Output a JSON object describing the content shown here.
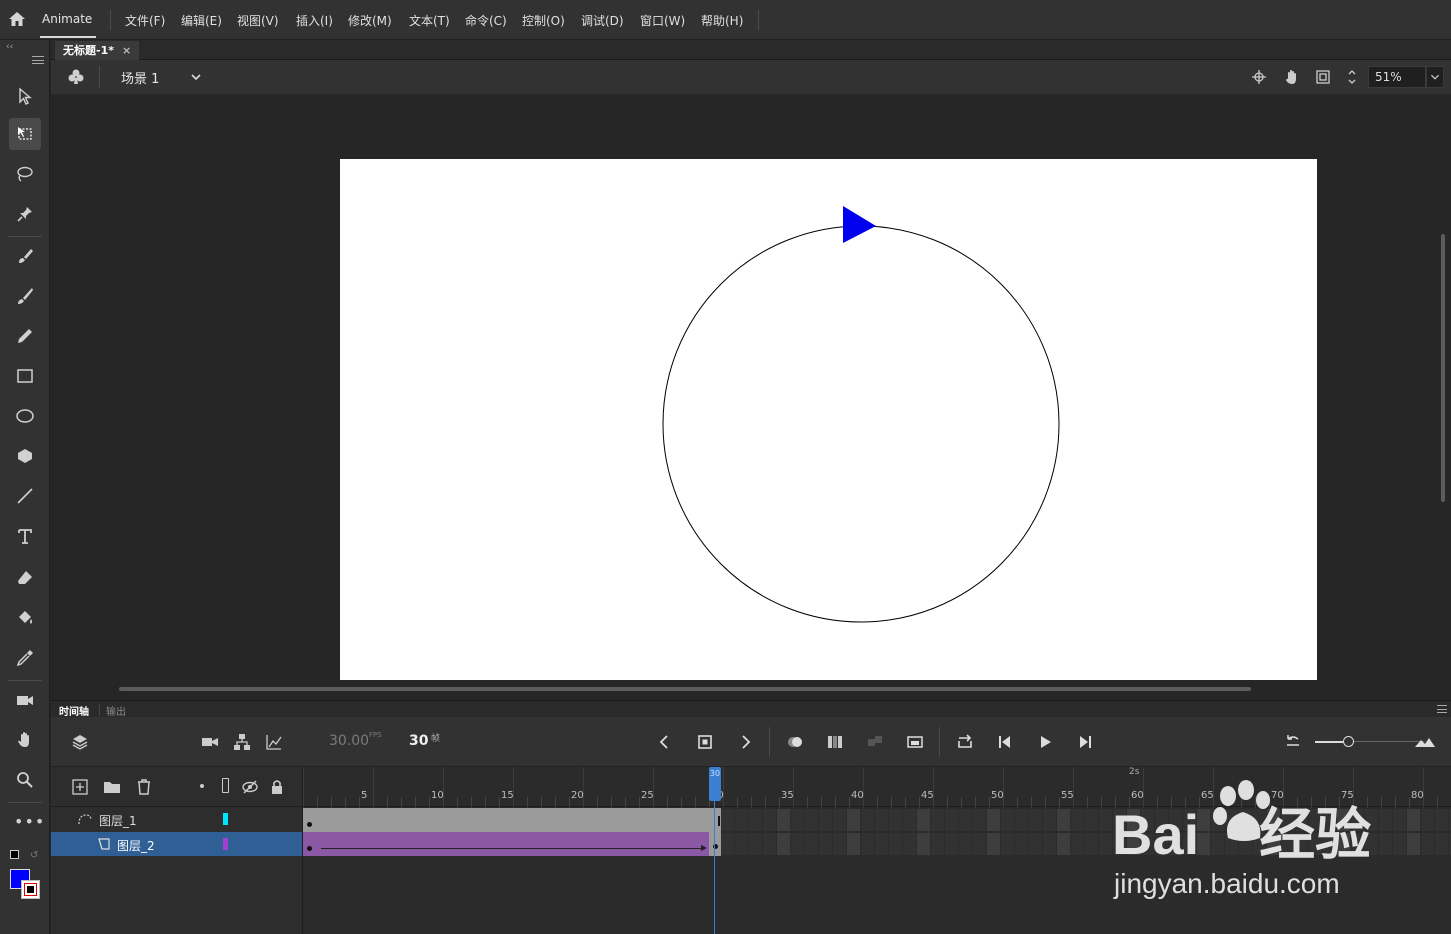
{
  "app": {
    "name": "Animate"
  },
  "menu": [
    "文件(F)",
    "编辑(E)",
    "视图(V)",
    "插入(I)",
    "修改(M)",
    "文本(T)",
    "命令(C)",
    "控制(O)",
    "调试(D)",
    "窗口(W)",
    "帮助(H)"
  ],
  "document": {
    "tab_title": "无标题-1*",
    "close_glyph": "×"
  },
  "scene": {
    "label": "场景 1",
    "zoom": "51%"
  },
  "stage": {
    "background": "#ffffff",
    "shape_stroke": "#000000",
    "triangle_color": "#0000ee"
  },
  "timeline": {
    "tabs": [
      "时间轴",
      "输出"
    ],
    "fps": "30.00",
    "fps_unit": "FPS",
    "current_frame": "30",
    "frame_unit": "帧",
    "ruler_labels": [
      "5",
      "10",
      "15",
      "20",
      "25",
      "30",
      "35",
      "40",
      "45",
      "50",
      "55",
      "60",
      "65",
      "70",
      "75",
      "80"
    ],
    "time_marker": "2s",
    "playhead_frame": "30",
    "layers": [
      {
        "name": "图层_1",
        "color": "#00e5ff",
        "type": "guide"
      },
      {
        "name": "图层_2",
        "color": "#a040d0",
        "type": "guided",
        "selected": true
      }
    ]
  },
  "colors": {
    "fill": "#0000ff",
    "stroke": "#000000"
  },
  "watermark": {
    "logo": "Bai 经验",
    "url": "jingyan.baidu.com"
  }
}
